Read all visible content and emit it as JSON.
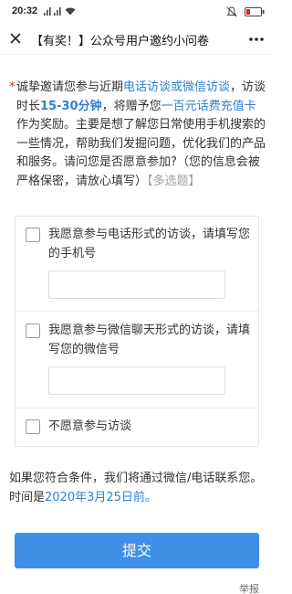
{
  "status_bar": {
    "time": "20:32"
  },
  "nav": {
    "title": "【有奖！】公众号用户邀约小问卷",
    "close_icon": "close-icon",
    "more_icon": "more-icon"
  },
  "question": {
    "required_mark": "*",
    "seg1": "诚挚邀请您参与近期",
    "seg2": "电话访谈或微信访谈",
    "seg3": "，访谈时长",
    "seg4": "15-30分钟",
    "seg5": "，将赠予您",
    "seg6": "一百元话费充值卡",
    "seg7": "作为奖励。主要是想了解您日常使用手机搜索的一些情况，帮助我们发掘问题，优化我们的产品和服务。请问您是否愿意参加?（您的信息会被严格保密，请放心填写）",
    "hint": "【多选题】"
  },
  "options": [
    {
      "label": "我愿意参与电话形式的访谈，请填写您的手机号",
      "input_value": ""
    },
    {
      "label": "我愿意参与微信聊天形式的访谈，请填写您的微信号",
      "input_value": ""
    },
    {
      "label": "不愿意参与访谈"
    }
  ],
  "note": {
    "seg1": "如果您符合条件，我们将通过微信/电话联系您。时间是",
    "date": "2020年3月25日前。"
  },
  "submit_label": "提交",
  "report_label": "举报",
  "colors": {
    "accent": "#3e8fe5",
    "highlight": "#2d7fd6",
    "required": "#e02020",
    "hint": "#9aa0a6"
  }
}
